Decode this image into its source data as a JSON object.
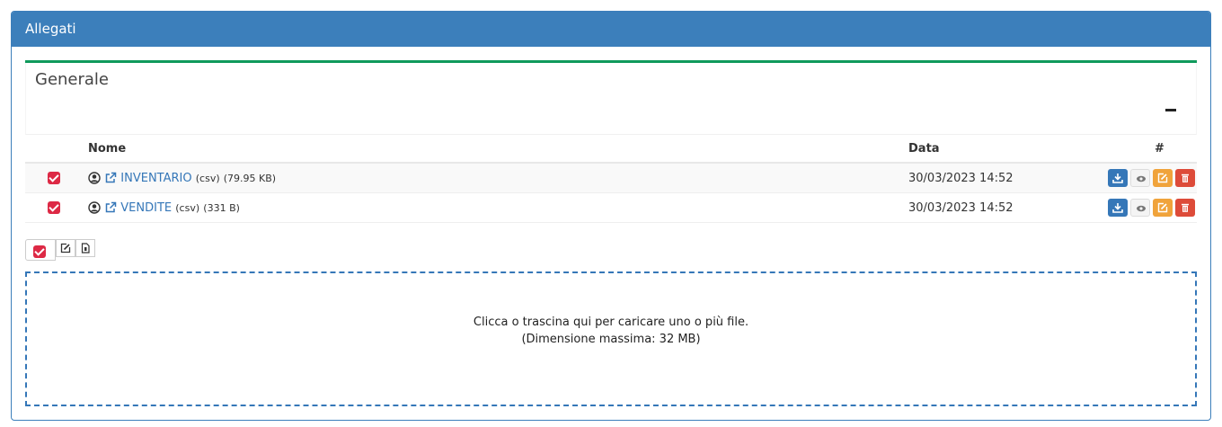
{
  "panel": {
    "title": "Allegati"
  },
  "box": {
    "title": "Generale"
  },
  "table": {
    "headers": {
      "name": "Nome",
      "date": "Data",
      "actions": "#"
    },
    "rows": [
      {
        "name": "INVENTARIO",
        "ext": "(csv)",
        "size": "(79.95 KB)",
        "date": "30/03/2023 14:52",
        "checked": true
      },
      {
        "name": "VENDITE",
        "ext": "(csv)",
        "size": "(331 B)",
        "date": "30/03/2023 14:52",
        "checked": true
      }
    ]
  },
  "dropzone": {
    "line1": "Clicca o trascina qui per caricare uno o più file.",
    "line2": "(Dimensione massima: 32 MB)"
  },
  "colors": {
    "header": "#3c7fbb",
    "accent": "#109a5c",
    "check": "#dd2945",
    "link": "#3577b8",
    "orange": "#f0a33b",
    "red": "#dd4b39"
  },
  "icons": [
    "user-circle-icon",
    "external-link-icon",
    "download-icon",
    "eye-icon",
    "edit-icon",
    "trash-icon",
    "file-icon",
    "minus-icon"
  ]
}
